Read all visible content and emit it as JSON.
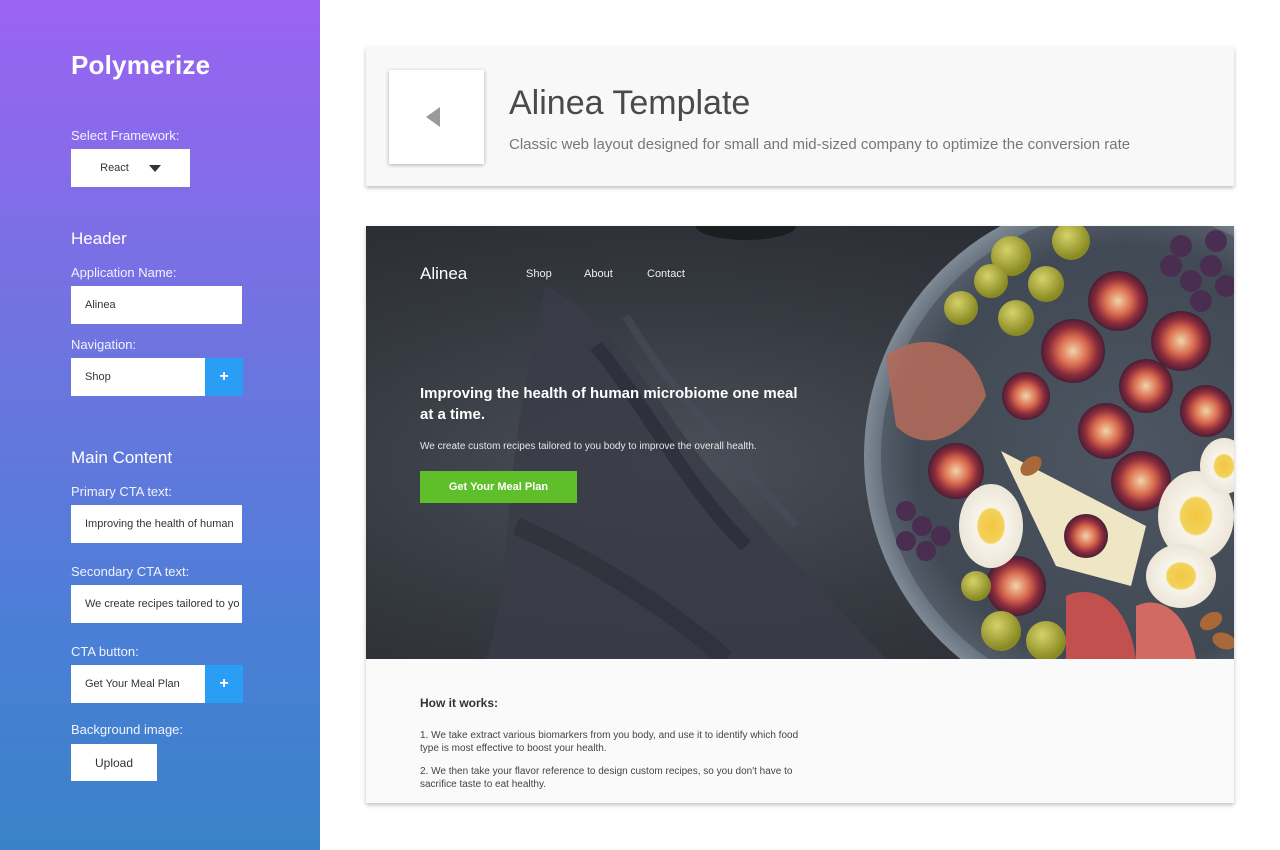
{
  "sidebar": {
    "brand": "Polymerize",
    "framework_label": "Select Framework:",
    "framework_value": "React",
    "header_section": "Header",
    "app_name_label": "Application Name:",
    "app_name_value": "Alinea",
    "navigation_label": "Navigation:",
    "navigation_value": "Shop",
    "add_label": "+",
    "main_section": "Main Content",
    "primary_cta_label": "Primary CTA text:",
    "primary_cta_value": "Improving the health of human",
    "secondary_cta_label": "Secondary CTA text:",
    "secondary_cta_value": "We create recipes tailored to yo",
    "cta_button_label": "CTA button:",
    "cta_button_value": "Get Your Meal Plan",
    "background_label": "Background image:",
    "upload_label": "Upload"
  },
  "template": {
    "title": "Alinea Template",
    "subtitle": "Classic web layout designed for small and mid-sized company to optimize the conversion rate"
  },
  "preview": {
    "logo": "Alinea",
    "nav": [
      "Shop",
      "About",
      "Contact"
    ],
    "headline": "Improving the health of human microbiome one meal at a time.",
    "subtext": "We create custom recipes tailored to you body to improve the overall health.",
    "cta": "Get Your Meal Plan",
    "how_title": "How it works:",
    "how_items": [
      "1. We take extract various biomarkers from you body, and use it to identify which food type is most effective to boost your health.",
      "2. We then take your flavor reference to design custom recipes, so you don't have to sacrifice taste to eat healthy."
    ]
  },
  "colors": {
    "sidebar_top": "#9b63f3",
    "sidebar_bottom": "#3a82c8",
    "add_button": "#2a9df4",
    "cta_green": "#5fbf2b"
  },
  "icons": {
    "back": "back-arrow-icon",
    "dropdown": "chevron-down-icon",
    "add": "plus-icon"
  }
}
